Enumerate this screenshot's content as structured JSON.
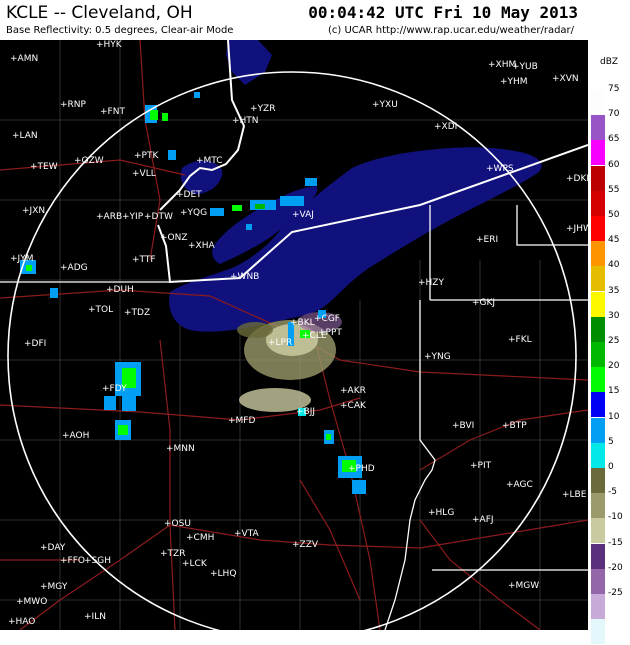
{
  "header": {
    "title": "KCLE -- Cleveland, OH",
    "time": "00:04:42 UTC Fri 10 May 2013",
    "subtitle": "Base Reflectivity: 0.5 degrees, Clear-air Mode",
    "credit": "(c) UCAR   http://www.rap.ucar.edu/weather/radar/"
  },
  "legend": {
    "unit": "dBZ",
    "entries": [
      {
        "value": "75",
        "color": "#fdfdfd"
      },
      {
        "value": "70",
        "color": "#9854c6"
      },
      {
        "value": "65",
        "color": "#f800fd"
      },
      {
        "value": "60",
        "color": "#bc0000"
      },
      {
        "value": "55",
        "color": "#d40000"
      },
      {
        "value": "50",
        "color": "#fd0000"
      },
      {
        "value": "45",
        "color": "#fd9500"
      },
      {
        "value": "40",
        "color": "#e5bc00"
      },
      {
        "value": "35",
        "color": "#fdf800"
      },
      {
        "value": "30",
        "color": "#008e00"
      },
      {
        "value": "25",
        "color": "#01b801"
      },
      {
        "value": "20",
        "color": "#02fd02"
      },
      {
        "value": "15",
        "color": "#0000f6"
      },
      {
        "value": "10",
        "color": "#019ff4"
      },
      {
        "value": "5",
        "color": "#04e9e7"
      },
      {
        "value": "0",
        "color": "#6a6a3a"
      },
      {
        "value": "-5",
        "color": "#9a9a6a"
      },
      {
        "value": "-10",
        "color": "#cacaa0"
      },
      {
        "value": "-15",
        "color": "#5a2f7c"
      },
      {
        "value": "-20",
        "color": "#9266a8"
      },
      {
        "value": "-25",
        "color": "#c8aad8"
      },
      {
        "value": "",
        "color": "#e4f8fc"
      }
    ]
  },
  "cities": [
    "HYK",
    "AMN",
    "RNP",
    "LAN",
    "TEW",
    "OZW",
    "JXN",
    "JYM",
    "ADG",
    "DFI",
    "FNT",
    "PTK",
    "VLL",
    "MTC",
    "DET",
    "YQG",
    "ARB",
    "YIP",
    "DTW",
    "ONZ",
    "XHA",
    "TTF",
    "DUH",
    "TOL",
    "TDZ",
    "FDY",
    "AOH",
    "MNN",
    "MFD",
    "CAK",
    "AKR",
    "BJJ",
    "PHD",
    "OSU",
    "CMH",
    "TZR",
    "LCK",
    "LHQ",
    "VTA",
    "ZZV",
    "DAY",
    "FFO",
    "SGH",
    "MWO",
    "MGY",
    "HAO",
    "ILN",
    "HTN",
    "YZR",
    "YXU",
    "XDI",
    "WPS",
    "ERI",
    "DKK",
    "JHW",
    "HZY",
    "GKJ",
    "YNG",
    "FKL",
    "BVI",
    "BTP",
    "PIT",
    "AGC",
    "LBE",
    "HLG",
    "AFJ",
    "MGW",
    "YHM",
    "XVN",
    "XHM",
    "YUB",
    "CLE",
    "CGF",
    "BKL",
    "PPT",
    "VAJ",
    "WNB",
    "LPR"
  ],
  "colors": {
    "background": "#000000",
    "lake": "#11117e",
    "range_ring": "#ffffff",
    "state_lines": "#ffffff",
    "roads": "#8b1c1c",
    "county_lines": "#3a3a3a"
  }
}
